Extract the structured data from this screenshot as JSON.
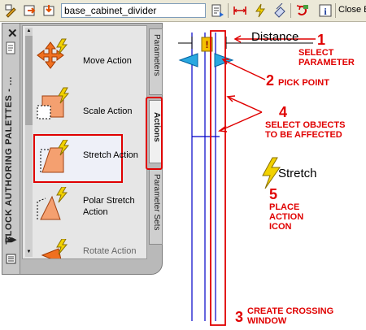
{
  "toolbar": {
    "block_name": "base_cabinet_divider",
    "close_label": "Close B",
    "icons": [
      "edit-block-icon",
      "save-block-icon",
      "save-as-icon",
      "authoring-palette-icon",
      "parameter-icon",
      "action-icon",
      "parameter-set-icon",
      "refresh-icon",
      "info-icon"
    ]
  },
  "palette": {
    "title": "BLOCK AUTHORING PALETTES - ...",
    "items": [
      {
        "label": "Move Action",
        "icon": "move-action-icon"
      },
      {
        "label": "Scale Action",
        "icon": "scale-action-icon"
      },
      {
        "label": "Stretch Action",
        "icon": "stretch-action-icon"
      },
      {
        "label": "Polar Stretch Action",
        "icon": "polar-stretch-action-icon"
      },
      {
        "label": "Rotate Action",
        "icon": "rotate-action-icon"
      }
    ],
    "tabs": [
      "Parameters",
      "Actions",
      "Parameter Sets"
    ],
    "active_tab": "Actions"
  },
  "drawing": {
    "distance_label": "Distance",
    "stretch_label": "Stretch",
    "annotations": [
      {
        "num": "1",
        "text": "SELECT PARAMETER"
      },
      {
        "num": "2",
        "text": "PICK POINT"
      },
      {
        "num": "4",
        "text": "SELECT OBJECTS TO BE AFFECTED"
      },
      {
        "num": "5",
        "text": "PLACE ACTION ICON"
      },
      {
        "num": "3",
        "text": "CREATE CROSSING WINDOW"
      }
    ]
  },
  "colors": {
    "annotation": "#e00000",
    "geometry": "#0000c8",
    "param_grip": "#29a8e0",
    "toolbar": "#ece9d8",
    "palette": "#b9b9b9"
  }
}
